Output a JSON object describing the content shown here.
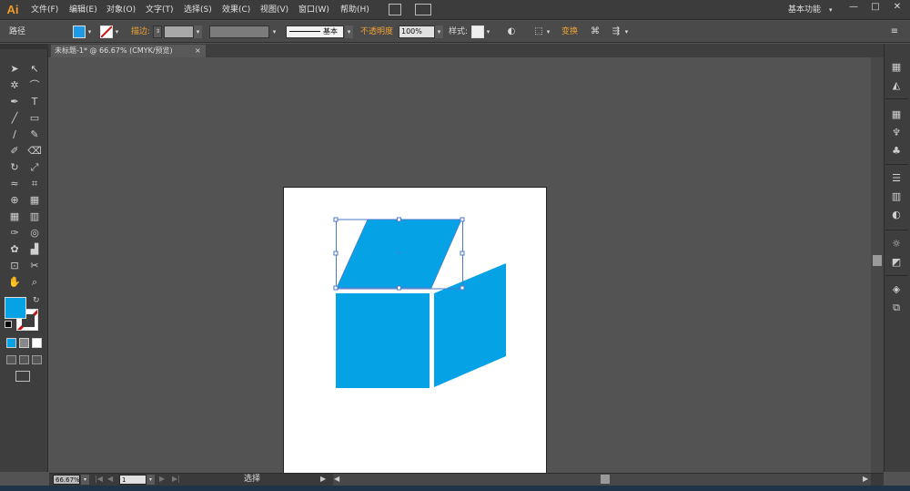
{
  "app": {
    "logo": "Ai",
    "menus": [
      "文件(F)",
      "编辑(E)",
      "对象(O)",
      "文字(T)",
      "选择(S)",
      "效果(C)",
      "视图(V)",
      "窗口(W)",
      "帮助(H)"
    ],
    "workspace": "基本功能",
    "window_buttons": [
      "—",
      "□",
      "✕"
    ]
  },
  "controlbar": {
    "object_type": "路径",
    "fill_color": "#1e9ae8",
    "stroke_label": "描边:",
    "brush_label": "基本",
    "opacity_label": "不透明度",
    "opacity_value": "100%",
    "style_label": "样式:",
    "transform_label": "变换"
  },
  "document": {
    "tab_title": "未标题-1* @ 66.67% (CMYK/预览)",
    "tab_close": "×"
  },
  "artwork": {
    "shape_color": "#06a2e6",
    "selection_color": "#4a79c9"
  },
  "statusbar": {
    "zoom": "66.67%",
    "artboard_number": "1",
    "tool_status": "选择"
  },
  "icons": {
    "tools": [
      "selection-tool-icon",
      "direct-selection-tool-icon",
      "magic-wand-tool-icon",
      "lasso-tool-icon",
      "pen-tool-icon",
      "type-tool-icon",
      "line-tool-icon",
      "rectangle-tool-icon",
      "paintbrush-tool-icon",
      "pencil-tool-icon",
      "blob-brush-tool-icon",
      "eraser-tool-icon",
      "rotate-tool-icon",
      "scale-tool-icon",
      "width-tool-icon",
      "free-transform-tool-icon",
      "shape-builder-tool-icon",
      "perspective-grid-tool-icon",
      "mesh-tool-icon",
      "gradient-tool-icon",
      "eyedropper-tool-icon",
      "blend-tool-icon",
      "symbol-sprayer-tool-icon",
      "column-graph-tool-icon",
      "artboard-tool-icon",
      "slice-tool-icon",
      "hand-tool-icon",
      "zoom-tool-icon"
    ]
  }
}
